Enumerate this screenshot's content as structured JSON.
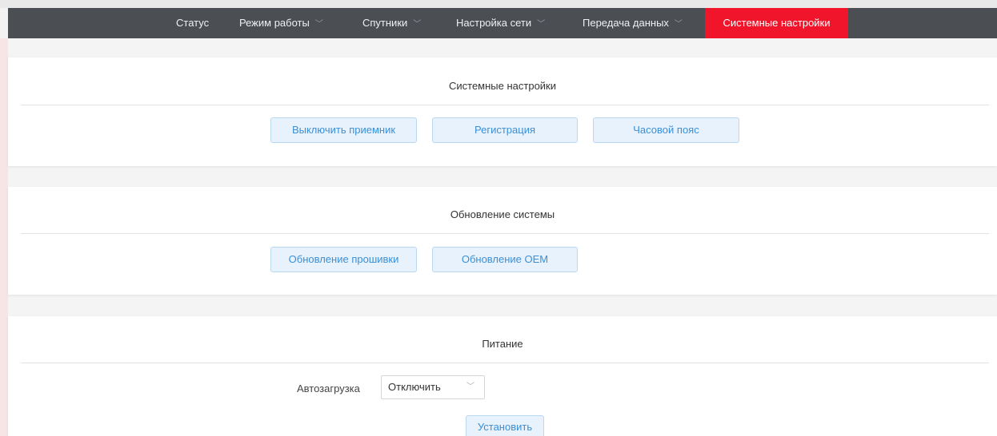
{
  "nav": {
    "items": [
      {
        "label": "Статус",
        "has_dropdown": false
      },
      {
        "label": "Режим работы",
        "has_dropdown": true
      },
      {
        "label": "Спутники",
        "has_dropdown": true
      },
      {
        "label": "Настройка сети",
        "has_dropdown": true
      },
      {
        "label": "Передача данных",
        "has_dropdown": true
      },
      {
        "label": "Системные настройки",
        "has_dropdown": false,
        "active": true
      }
    ],
    "chevron": "﹀"
  },
  "system_settings": {
    "title": "Системные настройки",
    "buttons": [
      "Выключить приемник",
      "Регистрация",
      "Часовой пояс"
    ]
  },
  "system_update": {
    "title": "Обновление системы",
    "buttons": [
      "Обновление прошивки",
      "Обновление OEM"
    ]
  },
  "power": {
    "title": "Питание",
    "autoload_label": "Автозагрузка",
    "autoload_value": "Отключить",
    "apply_button": "Установить"
  },
  "colors": {
    "navbar_bg": "#4b4f54",
    "active_tab": "#f0152a",
    "button_text": "#3b8fd6",
    "button_bg": "#e8f2fc"
  }
}
